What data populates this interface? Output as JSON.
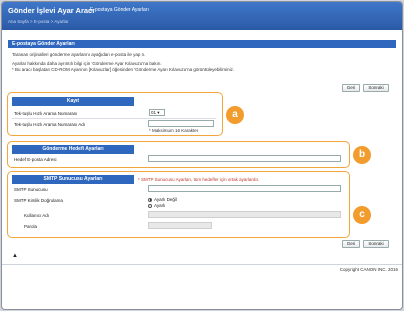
{
  "header": {
    "app_title": "Gönder İşlevi Ayar Aracı",
    "subtitle": "E-postaya Gönder Ayarları",
    "breadcrumb": "Ana Sayfa > E-posta > Ayarlar"
  },
  "page": {
    "section_title": "E-postaya Gönder Ayarları",
    "desc_line1": "Taranan orijinalleri gönderme ayarlarını ayağıdan e-posta ile yap n.",
    "desc_line2": "Ayarlar hakkında daha ayrıntılı bilgi için 'Gönderme Ayar Kılavuzu'na bakın.",
    "desc_line3": "* Bu aracı başlatan CD-ROM Ayarının [Kılavuzlar] öğesinden 'Gönderme Ayarı Kılavuzu'na görüntüleyebilirsiniz."
  },
  "buttons": {
    "back": "Geri",
    "next": "Sonraki"
  },
  "register": {
    "heading": "Kayıt",
    "speed_dial_label": "Tek-tuşlu Hızlı Arama Numarası",
    "speed_dial_value": "01",
    "speed_dial_name_label": "Tek-tuşlu Hızlı Arama Numarası Adı",
    "max_chars_note": "* Maksimum 16 Karakter"
  },
  "destination": {
    "heading": "Gönderme Hedefi Ayarları",
    "email_label": "Hedef E-posta Adresi"
  },
  "smtp": {
    "heading": "SMTP Sunucusu Ayarları",
    "heading_note": "* SMTP Sunucusu Ayarları, tüm hedefler için ortak ayarlardır.",
    "server_label": "SMTP Sunucusu",
    "auth_label": "SMTP Kimlik Doğrulama",
    "auth_options": [
      "Ayarlı Değil",
      "Ayarlı"
    ],
    "username_label": "Kullanıcı Adı",
    "password_label": "Parola"
  },
  "badges": {
    "a": "a",
    "b": "b",
    "c": "c"
  },
  "footer": {
    "top_link": "▲",
    "copyright": "Copyright CANON INC. 2016"
  },
  "colors": {
    "header_blue": "#2f67be",
    "callout_orange": "#f1a53b",
    "badge_orange": "#f39c2e"
  }
}
